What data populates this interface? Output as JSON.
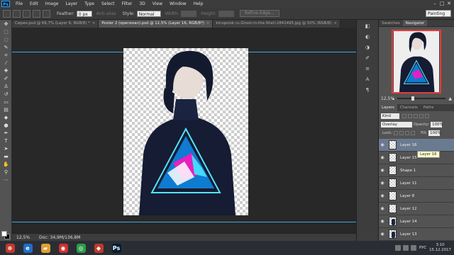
{
  "app": {
    "logo": "Ps"
  },
  "menu": [
    "File",
    "Edit",
    "Image",
    "Layer",
    "Type",
    "Select",
    "Filter",
    "3D",
    "View",
    "Window",
    "Help"
  ],
  "window_controls": [
    "–",
    "□",
    "✕"
  ],
  "options": {
    "feather_label": "Feather:",
    "feather_value": "0 px",
    "antialias_label": "Anti-alias",
    "style_label": "Style:",
    "style_value": "Normal",
    "width_label": "Width:",
    "height_label": "Height:",
    "refine_edge": "Refine Edge...",
    "workspace": "Painting"
  },
  "tabs": [
    {
      "label": "Сирин.psd @ 66,7% (Layer 6, RGB/8) *",
      "active": false
    },
    {
      "label": "Poster 2 (оригинал).psd @ 12,5% (Layer 16, RGB/8*)",
      "active": true
    },
    {
      "label": "kinopoisk.ru-Ghost-in-the-Shell-2841495.jpg @ 50% (RGB/8)",
      "active": false
    }
  ],
  "status": {
    "zoom": "12,5%",
    "doc": "Doc: 34,9M/136,8M"
  },
  "navigator": {
    "tabs": [
      "Swatches",
      "Navigator"
    ],
    "active_tab": "Navigator",
    "zoom": "12,5%"
  },
  "layers_panel": {
    "tabs": [
      "Layers",
      "Channels",
      "Paths"
    ],
    "active_tab": "Layers",
    "kind_label": "Kind",
    "blend_mode": "Overlay",
    "opacity_label": "Opacity:",
    "opacity_value": "100%",
    "lock_label": "Lock:",
    "fill_label": "Fill:",
    "fill_value": "100%",
    "layers": [
      {
        "name": "Layer 16",
        "selected": true,
        "person": false
      },
      {
        "name": "Layer 15",
        "selected": false,
        "person": false
      },
      {
        "name": "Shape 1",
        "selected": false,
        "person": false
      },
      {
        "name": "Layer 11",
        "selected": false,
        "person": false
      },
      {
        "name": "Layer 8",
        "selected": false,
        "person": false
      },
      {
        "name": "Layer 12",
        "selected": false,
        "person": false
      },
      {
        "name": "Layer 14",
        "selected": false,
        "person": true
      },
      {
        "name": "Layer 13",
        "selected": false,
        "person": true
      }
    ],
    "tooltip": "Layer 16"
  },
  "taskbar": {
    "apps": [
      {
        "glyph": "⊕",
        "color": "#c0392b"
      },
      {
        "glyph": "e",
        "color": "#1e6fc4"
      },
      {
        "glyph": "▰",
        "color": "#e0a030"
      },
      {
        "glyph": "◉",
        "color": "#d03030"
      },
      {
        "glyph": "◎",
        "color": "#2a9d4a"
      },
      {
        "glyph": "◆",
        "color": "#c0392b"
      },
      {
        "glyph": "Ps",
        "color": "#001d34"
      }
    ],
    "lang": "РУС",
    "time": "3:10",
    "date": "15.12.2017"
  },
  "colors": {
    "accent_guide": "#3aa8e8",
    "nav_frame": "#e83b3b",
    "selected_layer": "#6a7a90"
  }
}
